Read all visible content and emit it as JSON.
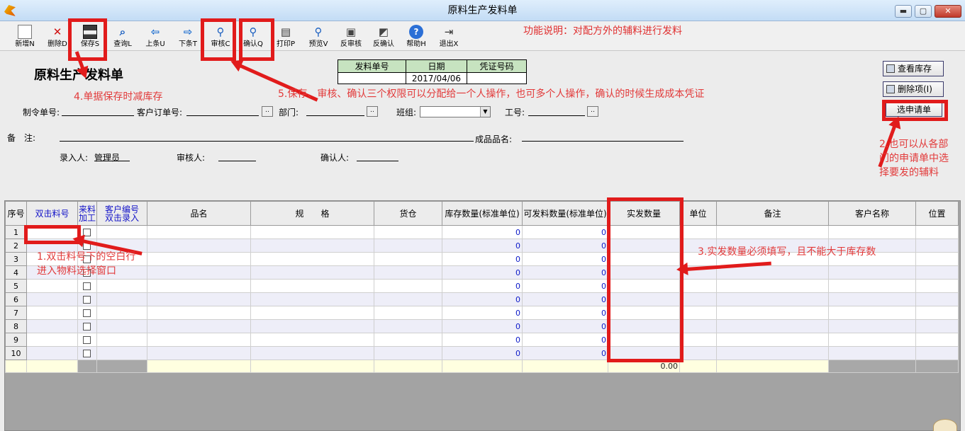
{
  "window": {
    "title": "原料生产发料单",
    "minimize": "▬",
    "maximize": "▢",
    "close": "✕"
  },
  "toolbar": [
    {
      "label": "新增N",
      "icon": "new-document-icon"
    },
    {
      "label": "删除D",
      "icon": "delete-icon"
    },
    {
      "label": "保存S",
      "icon": "save-icon"
    },
    {
      "label": "查询L",
      "icon": "query-icon"
    },
    {
      "label": "上条U",
      "icon": "arrow-left-icon"
    },
    {
      "label": "下条T",
      "icon": "arrow-right-icon"
    },
    {
      "label": "审核C",
      "icon": "audit-magnifier-icon"
    },
    {
      "label": "确认Q",
      "icon": "confirm-magnifier-icon"
    },
    {
      "label": "打印P",
      "icon": "printer-icon"
    },
    {
      "label": "预览V",
      "icon": "preview-magnifier-icon"
    },
    {
      "label": "反审核",
      "icon": "unaudit-icon"
    },
    {
      "label": "反确认",
      "icon": "unconfirm-icon"
    },
    {
      "label": "帮助H",
      "icon": "help-icon"
    },
    {
      "label": "退出X",
      "icon": "exit-icon"
    }
  ],
  "function_note": "功能说明：对配方外的辅料进行发料",
  "form": {
    "title": "原料生产发料单",
    "doc_header": {
      "doc_no_label": "发料单号",
      "date_label": "日期",
      "voucher_label": "凭证号码",
      "doc_no": "",
      "date": "2017/04/06",
      "voucher": ""
    },
    "order_no_label": "制令单号:",
    "customer_order_label": "客户订单号:",
    "dept_label": "部门:",
    "team_label": "班组:",
    "emp_no_label": "工号:",
    "remark_label": "备　注:",
    "product_name_label": "成品品名:",
    "entered_by_label": "录入人:",
    "entered_by": "管理员",
    "reviewer_label": "审核人:",
    "confirmer_label": "确认人:",
    "browse": ".."
  },
  "side_buttons": {
    "check_stock": "查看库存",
    "delete_item": "删除项(I)",
    "select_request": "选申请单"
  },
  "grid": {
    "headers": {
      "seq": "序号",
      "item_code": "双击料号",
      "external_top": "来料",
      "external_bottom": "加工",
      "cust_code_top": "客户编号",
      "cust_code_bottom": "双击录入",
      "name": "品名",
      "spec": "规　　格",
      "warehouse": "货仓",
      "stock_qty": "库存数量(标准单位)",
      "avail_qty": "可发料数量(标准单位)",
      "actual_qty": "实发数量",
      "unit": "单位",
      "remark": "备注",
      "customer": "客户名称",
      "location": "位置"
    },
    "rows": [
      {
        "seq": "1",
        "stock": "0",
        "avail": "0"
      },
      {
        "seq": "2",
        "stock": "0",
        "avail": "0"
      },
      {
        "seq": "3",
        "stock": "0",
        "avail": "0"
      },
      {
        "seq": "4",
        "stock": "0",
        "avail": "0"
      },
      {
        "seq": "5",
        "stock": "0",
        "avail": "0"
      },
      {
        "seq": "6",
        "stock": "0",
        "avail": "0"
      },
      {
        "seq": "7",
        "stock": "0",
        "avail": "0"
      },
      {
        "seq": "8",
        "stock": "0",
        "avail": "0"
      },
      {
        "seq": "9",
        "stock": "0",
        "avail": "0"
      },
      {
        "seq": "10",
        "stock": "0",
        "avail": "0"
      }
    ],
    "total_actual": "0.00"
  },
  "annotations": {
    "a1": "1.双击料号下的空白行\n进入物料选择窗口",
    "a2": "2.也可以从各部\n门的申请单中选\n择要发的辅料",
    "a3": "3.实发数量必须填写，且不能大于库存数",
    "a4": "4.单据保存时减库存",
    "a5": "5.保存、审核、确认三个权限可以分配给一个人操作，也可多个人操作，确认的时候生成成本凭证"
  },
  "colors": {
    "annotation_red": "#e11b1b",
    "header_green": "#c7e3c0",
    "number_blue": "#0b18c8"
  }
}
